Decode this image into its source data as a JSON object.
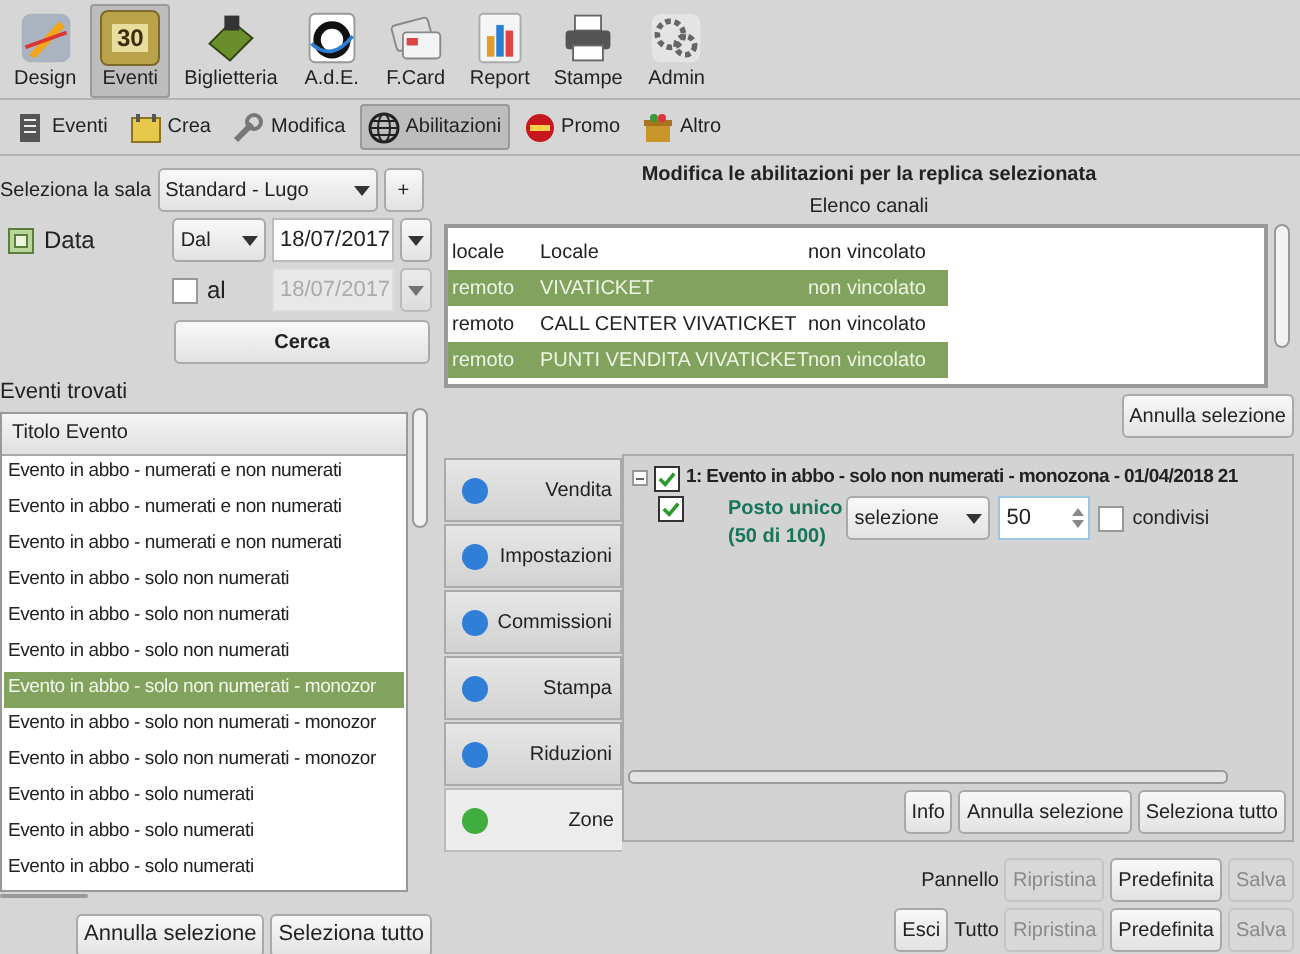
{
  "toolbar": [
    {
      "label": "Design",
      "kind": "design",
      "selected": false
    },
    {
      "label": "Eventi",
      "kind": "calendar",
      "day": "30",
      "selected": true
    },
    {
      "label": "Biglietteria",
      "kind": "ticket",
      "selected": false
    },
    {
      "label": "A.d.E.",
      "kind": "ade",
      "selected": false
    },
    {
      "label": "F.Card",
      "kind": "card",
      "selected": false
    },
    {
      "label": "Report",
      "kind": "report",
      "selected": false
    },
    {
      "label": "Stampe",
      "kind": "printer",
      "selected": false
    },
    {
      "label": "Admin",
      "kind": "gear",
      "selected": false
    }
  ],
  "subtoolbar": [
    {
      "label": "Eventi",
      "kind": "list",
      "selected": false
    },
    {
      "label": "Crea",
      "kind": "create",
      "selected": false
    },
    {
      "label": "Modifica",
      "kind": "tools",
      "selected": false
    },
    {
      "label": "Abilitazioni",
      "kind": "globe",
      "selected": true
    },
    {
      "label": "Promo",
      "kind": "promo",
      "selected": false
    },
    {
      "label": "Altro",
      "kind": "box",
      "selected": false
    }
  ],
  "filters": {
    "hall_label": "Seleziona la sala",
    "hall_value": "Standard - Lugo",
    "add_button": "+",
    "date_label": "Data",
    "date_checked": true,
    "from_mode": "Dal",
    "from_date": "18/07/2017",
    "to_label": "al",
    "to_checked": false,
    "to_date": "18/07/2017",
    "search_button": "Cerca"
  },
  "events": {
    "label": "Eventi trovati",
    "column": "Titolo Evento",
    "rows": [
      {
        "title": "Evento in abbo - numerati e non numerati",
        "selected": false
      },
      {
        "title": "Evento in abbo - numerati e non numerati",
        "selected": false
      },
      {
        "title": "Evento in abbo - numerati e non numerati",
        "selected": false
      },
      {
        "title": "Evento in abbo - solo non numerati",
        "selected": false
      },
      {
        "title": "Evento in abbo - solo non numerati",
        "selected": false
      },
      {
        "title": "Evento in abbo - solo non numerati",
        "selected": false
      },
      {
        "title": "Evento in abbo - solo non numerati - monozor",
        "selected": true
      },
      {
        "title": "Evento in abbo - solo non numerati - monozor",
        "selected": false
      },
      {
        "title": "Evento in abbo - solo non numerati - monozor",
        "selected": false
      },
      {
        "title": "Evento in abbo - solo numerati",
        "selected": false
      },
      {
        "title": "Evento in abbo - solo numerati",
        "selected": false
      },
      {
        "title": "Evento in abbo - solo numerati",
        "selected": false
      }
    ],
    "buttons": [
      "Annulla selezione",
      "Seleziona tutto"
    ]
  },
  "panel": {
    "title": "Modifica le abilitazioni per la replica selezionata",
    "channels_label": "Elenco canali",
    "channels": [
      {
        "type": "locale",
        "name": "Locale",
        "constraint": "non vincolato",
        "selected": false
      },
      {
        "type": "remoto",
        "name": "VIVATICKET",
        "constraint": "non vincolato",
        "selected": true
      },
      {
        "type": "remoto",
        "name": "CALL CENTER VIVATICKET",
        "constraint": "non vincolato",
        "selected": false
      },
      {
        "type": "remoto",
        "name": "PUNTI VENDITA VIVATICKET",
        "constraint": "non vincolato",
        "selected": true
      }
    ],
    "channels_button": "Annulla selezione",
    "tabs": [
      {
        "label": "Vendita",
        "color": "#2f7fd8",
        "selected": false
      },
      {
        "label": "Impostazioni",
        "color": "#2f7fd8",
        "selected": false
      },
      {
        "label": "Commissioni",
        "color": "#2f7fd8",
        "selected": false
      },
      {
        "label": "Stampa",
        "color": "#2f7fd8",
        "selected": false
      },
      {
        "label": "Riduzioni",
        "color": "#2f7fd8",
        "selected": false
      },
      {
        "label": "Zone",
        "color": "#3fae3f",
        "selected": true
      }
    ],
    "tree": {
      "title": "1: Evento in abbo - solo non numerati - monozona - 01/04/2018 21",
      "expanded": true,
      "checked": true,
      "zone": {
        "checked": true,
        "name": "Posto unico",
        "count": "(50 di 100)",
        "mode": "selezione",
        "value": "50",
        "shared_label": "condivisi",
        "shared": false
      }
    },
    "zone_buttons": [
      "Info",
      "Annulla selezione",
      "Seleziona tutto"
    ],
    "footer": [
      {
        "label": "Pannello",
        "buttons": [
          {
            "label": "Ripristina",
            "disabled": true
          },
          {
            "label": "Predefinita",
            "disabled": false
          },
          {
            "label": "Salva",
            "disabled": true
          }
        ]
      },
      {
        "label": "Tutto",
        "exit": "Esci",
        "buttons": [
          {
            "label": "Ripristina",
            "disabled": true
          },
          {
            "label": "Predefinita",
            "disabled": false
          },
          {
            "label": "Salva",
            "disabled": true
          }
        ]
      }
    ]
  }
}
